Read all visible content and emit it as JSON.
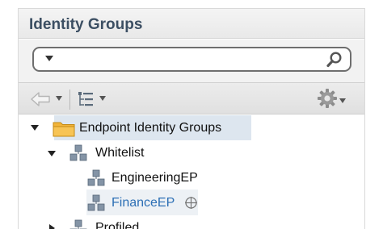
{
  "panel": {
    "title": "Identity Groups"
  },
  "search": {
    "value": "",
    "placeholder": ""
  },
  "toolbar": {
    "back_icon": "back-arrow-icon",
    "tree_view_icon": "tree-view-icon",
    "settings_icon": "gear-icon"
  },
  "tree": {
    "root": {
      "label": "Endpoint Identity Groups",
      "expanded": true
    },
    "whitelist": {
      "label": "Whitelist",
      "expanded": true,
      "children": [
        {
          "label": "EngineeringEP"
        },
        {
          "label": "FinanceEP",
          "selected": true
        }
      ]
    },
    "profiled": {
      "label": "Profiled",
      "expanded": false
    }
  },
  "colors": {
    "title": "#3c4f63",
    "selected_link": "#2c6fb5",
    "root_highlight": "#dde6ef",
    "folder": "#f2b43a"
  }
}
